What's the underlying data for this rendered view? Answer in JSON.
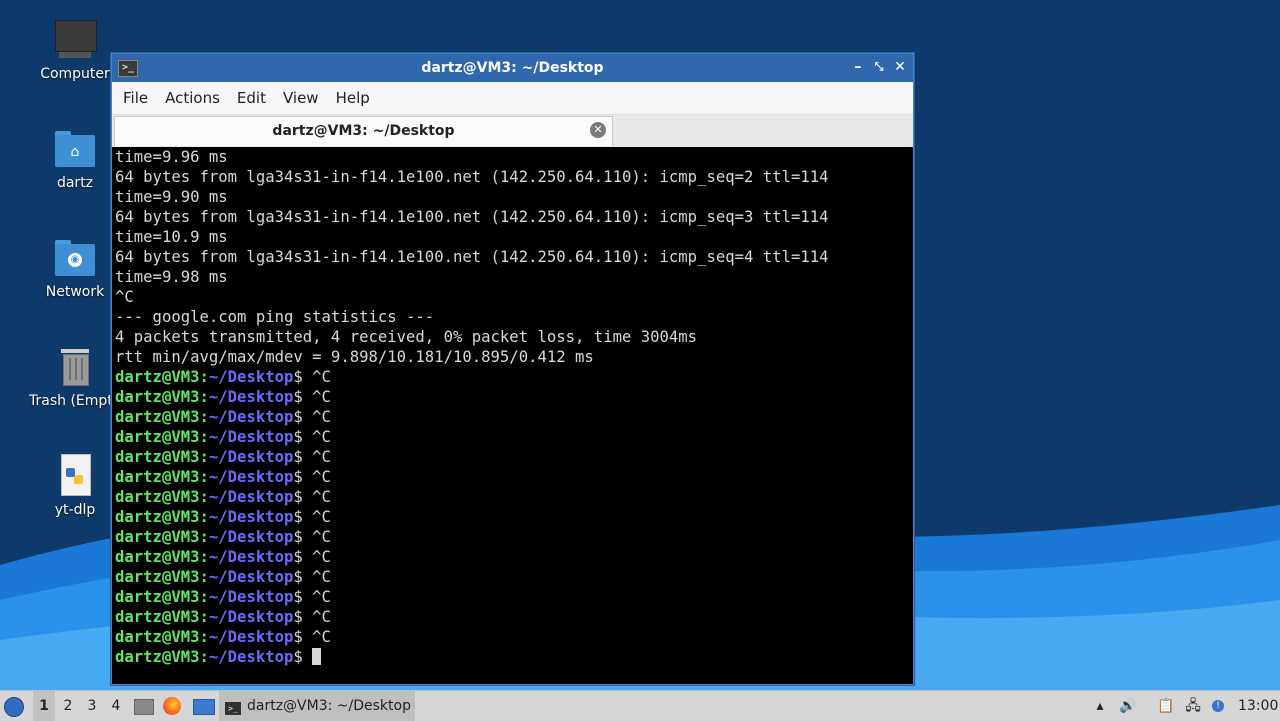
{
  "desktop": {
    "icons": [
      {
        "label": "Computer",
        "icon": "computer-icon"
      },
      {
        "label": "dartz",
        "icon": "home-folder-icon"
      },
      {
        "label": "Network",
        "icon": "network-folder-icon"
      },
      {
        "label": "Trash (Empty)",
        "icon": "trash-icon"
      },
      {
        "label": "yt-dlp",
        "icon": "python-file-icon"
      }
    ]
  },
  "window": {
    "title": "dartz@VM3: ~/Desktop",
    "menu": [
      "File",
      "Actions",
      "Edit",
      "View",
      "Help"
    ],
    "tab_label": "dartz@VM3: ~/Desktop"
  },
  "terminal": {
    "output": [
      "time=9.96 ms",
      "64 bytes from lga34s31-in-f14.1e100.net (142.250.64.110): icmp_seq=2 ttl=114",
      "time=9.90 ms",
      "64 bytes from lga34s31-in-f14.1e100.net (142.250.64.110): icmp_seq=3 ttl=114",
      "time=10.9 ms",
      "64 bytes from lga34s31-in-f14.1e100.net (142.250.64.110): icmp_seq=4 ttl=114",
      "time=9.98 ms",
      "^C",
      "--- google.com ping statistics ---",
      "4 packets transmitted, 4 received, 0% packet loss, time 3004ms",
      "rtt min/avg/max/mdev = 9.898/10.181/10.895/0.412 ms"
    ],
    "prompt_user": "dartz@VM3",
    "prompt_sep": ":",
    "prompt_path": "~/Desktop",
    "prompt_end": "$ ",
    "interrupted_count": 14,
    "interrupt_text": "^C"
  },
  "taskbar": {
    "workspaces": [
      "1",
      "2",
      "3",
      "4"
    ],
    "active_workspace": "1",
    "task_label": "dartz@VM3: ~/Desktop",
    "clock": "13:00"
  }
}
